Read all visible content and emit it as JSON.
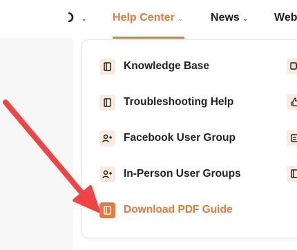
{
  "nav": {
    "items": [
      {
        "label": "",
        "chevron": "⌄"
      },
      {
        "label": "Help Center",
        "chevron": "⌄"
      },
      {
        "label": "News",
        "chevron": "⌄"
      },
      {
        "label": "Web"
      }
    ]
  },
  "dropdown": {
    "items": [
      {
        "label": "Knowledge Base",
        "icon": "book-icon"
      },
      {
        "label": "Troubleshooting Help",
        "icon": "book-icon"
      },
      {
        "label": "Facebook User Group",
        "icon": "users-icon"
      },
      {
        "label": "In-Person User Groups",
        "icon": "users-icon"
      },
      {
        "label": "Download PDF Guide",
        "icon": "book-icon",
        "active": true
      }
    ],
    "right_icons": [
      "video-icon",
      "thumbs-up-icon",
      "clipboard-icon",
      "book-icon"
    ]
  },
  "colors": {
    "accent": "#e67a3c",
    "icon_bg": "#fbeadf",
    "arrow": "#f04444",
    "text": "#222222"
  }
}
